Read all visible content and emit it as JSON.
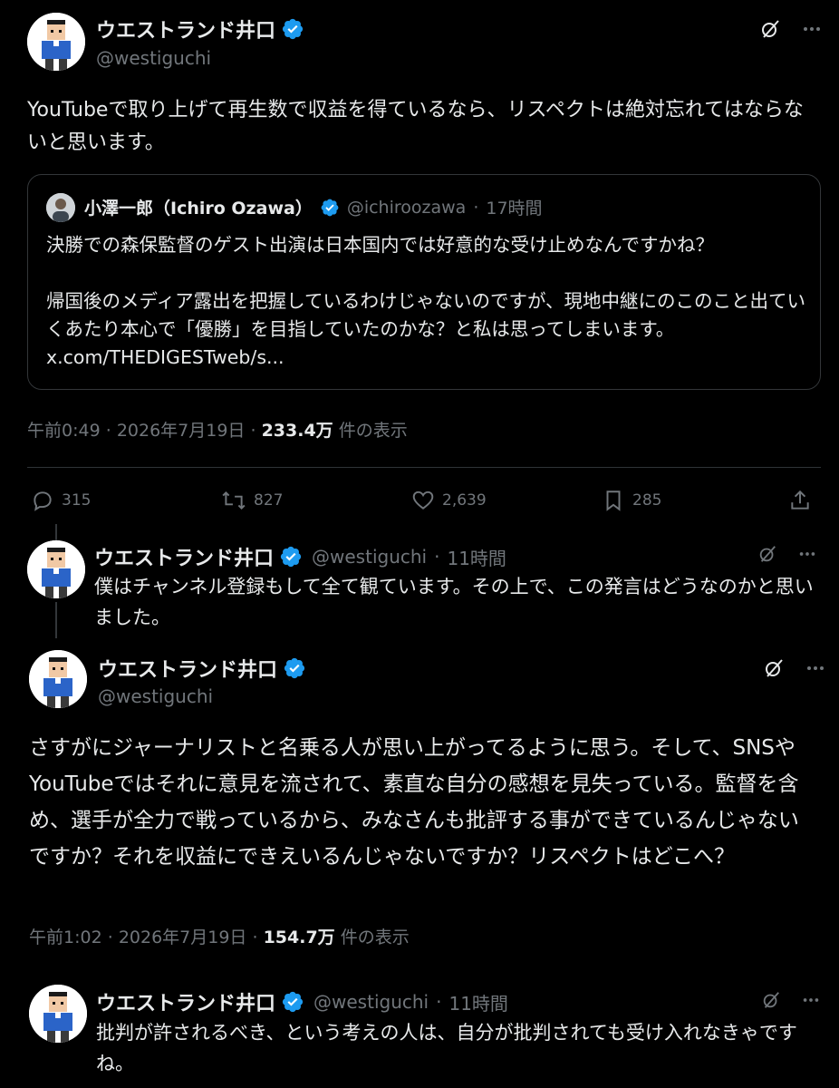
{
  "tweets": [
    {
      "author": "ウエストランド井口",
      "handle": "@westiguchi",
      "text": "YouTubeで取り上げて再生数で収益を得ているなら、リスペクトは絶対忘れてはならないと思います。",
      "meta": {
        "time": "午前0:49",
        "date": "2026年7月19日",
        "views": "233.4万",
        "views_suffix": "件の表示"
      },
      "quote": {
        "author": "小澤一郎（Ichiro Ozawa）",
        "handle": "@ichiroozawa",
        "ago": "17時間",
        "text_p1": "決勝での森保監督のゲスト出演は日本国内では好意的な受け止めなんですかね？",
        "text_p2": "帰国後のメディア露出を把握しているわけじゃないのですが、現地中継にのこのこと出ていくあたり本心で「優勝」を目指していたのかな？と私は思ってしまいます。",
        "link": "x.com/THEDIGESTweb/s..."
      },
      "actions": {
        "replies": "315",
        "reposts": "827",
        "likes": "2,639",
        "bookmarks": "285"
      }
    },
    {
      "author": "ウエストランド井口",
      "handle": "@westiguchi",
      "ago": "11時間",
      "text": "僕はチャンネル登録もして全て観ています。その上で、この発言はどうなのかと思いました。"
    },
    {
      "author": "ウエストランド井口",
      "handle": "@westiguchi",
      "text": "さすがにジャーナリストと名乗る人が思い上がってるように思う。そして、SNSやYouTubeではそれに意見を流されて、素直な自分の感想を見失っている。監督を含め、選手が全力で戦っているから、みなさんも批評する事ができているんじゃないですか？それを収益にできえいるんじゃないですか？リスペクトはどこへ？",
      "meta": {
        "time": "午前1:02",
        "date": "2026年7月19日",
        "views": "154.7万",
        "views_suffix": "件の表示"
      }
    },
    {
      "author": "ウエストランド井口",
      "handle": "@westiguchi",
      "ago": "11時間",
      "text": "批判が許されるべき、という考えの人は、自分が批判されても受け入れなきゃですね。"
    }
  ],
  "separator": "·",
  "icons": {
    "verified": "verified-badge-icon",
    "grok": "grok-icon",
    "more": "more-icon",
    "reply": "reply-icon",
    "repost": "repost-icon",
    "like": "like-icon",
    "bookmark": "bookmark-icon",
    "share": "share-icon"
  },
  "colors": {
    "background": "#000000",
    "text": "#e7e9ea",
    "muted": "#71767b",
    "verified": "#1d9bf0",
    "border": "#2f3336"
  }
}
